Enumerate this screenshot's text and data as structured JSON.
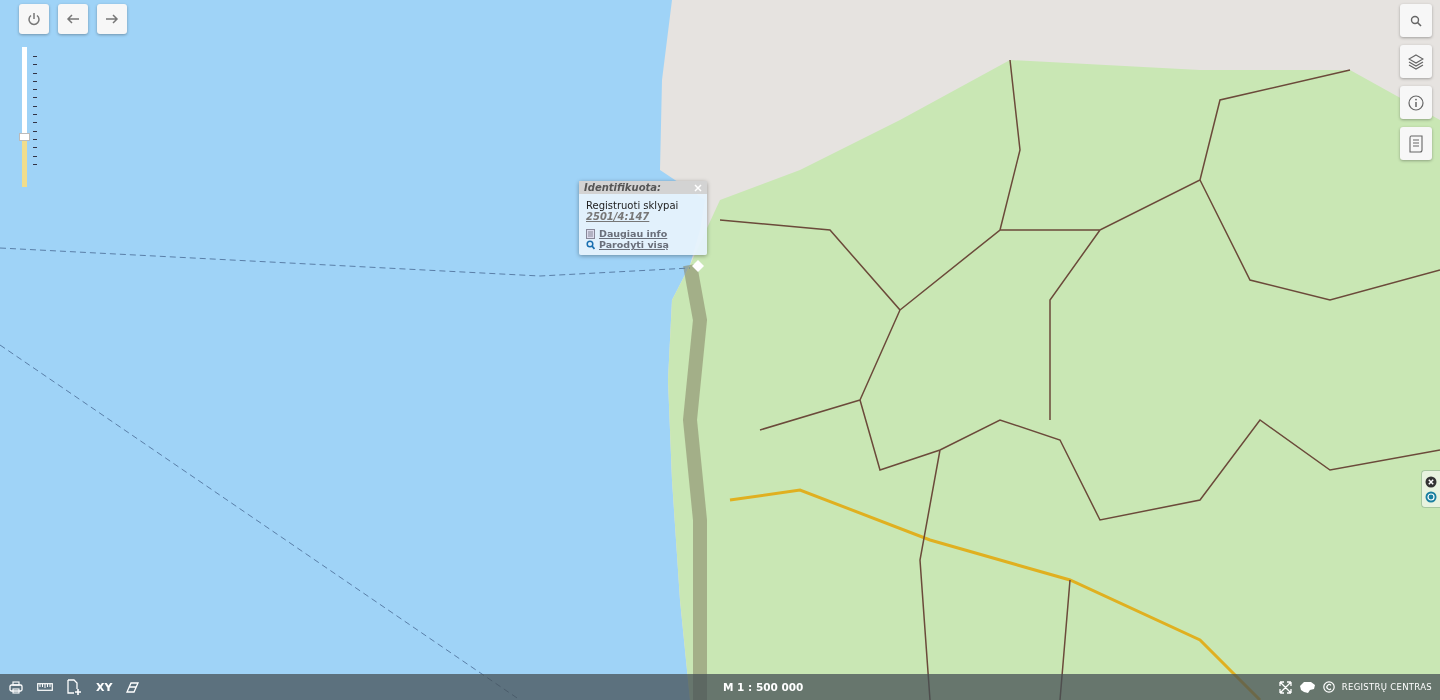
{
  "zoom_slider": {
    "level": 0.36
  },
  "popup": {
    "title": "Identifikuota:",
    "layer": "Registruoti sklypai",
    "parcel": "2501/4:147",
    "links": [
      {
        "kind": "info",
        "label": "Daugiau info"
      },
      {
        "kind": "zoom",
        "label": "Parodyti visą"
      }
    ]
  },
  "status_bar": {
    "tools": [
      {
        "kind": "print"
      },
      {
        "kind": "measure"
      },
      {
        "kind": "add-page"
      },
      {
        "kind": "text",
        "label": "XY"
      },
      {
        "kind": "eraser"
      }
    ],
    "scale": "M 1 : 500 000",
    "brand": "REGISTRŲ CENTRAS"
  }
}
